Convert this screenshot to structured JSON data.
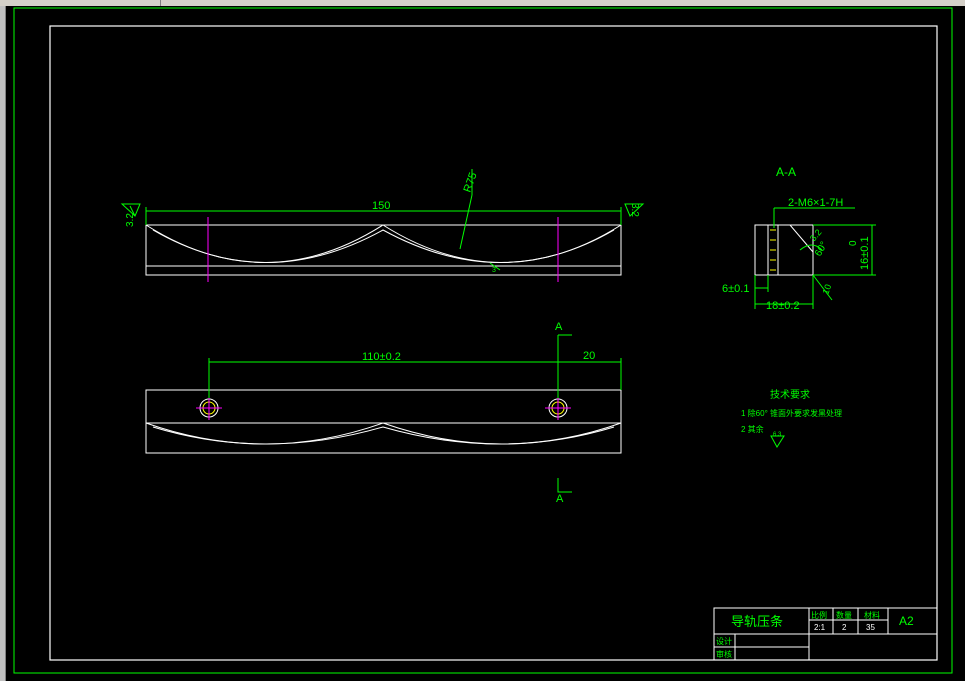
{
  "drawing": {
    "section_label": "A-A",
    "dims": {
      "length": "150",
      "radius": "R75",
      "rough_left": "3.2",
      "rough_right": "3.2",
      "small_mark": "3",
      "hole_spacing": "110±0.2",
      "edge_offset": "20",
      "section_a_top": "A",
      "section_a_bottom": "A",
      "thread": "2-M6×1-7H",
      "angle": "60°",
      "chamfer": "3.2",
      "height": "16±0.1",
      "height_zero": "0",
      "width_left": "6±0.1",
      "width_total": "18±0.2",
      "side_mark": "10"
    },
    "notes": {
      "title": "技术要求",
      "item1": "1  除60° 锥面外要求发黑处理",
      "item2": "2  其余",
      "rough_symbol": "6.3"
    }
  },
  "title_block": {
    "part_name": "导轨压条",
    "scale_label": "比例",
    "qty_label": "数量",
    "material_label": "材料",
    "scale_value": "2:1",
    "qty_value": "2",
    "material_value": "35",
    "sheet_size": "A2",
    "design_label": "设计",
    "review_label": "审核"
  },
  "colors": {
    "outline": "#00ff00",
    "part": "#ffffff",
    "centerline": "#ff00ff",
    "hatch": "#ffff00",
    "background": "#000000"
  }
}
